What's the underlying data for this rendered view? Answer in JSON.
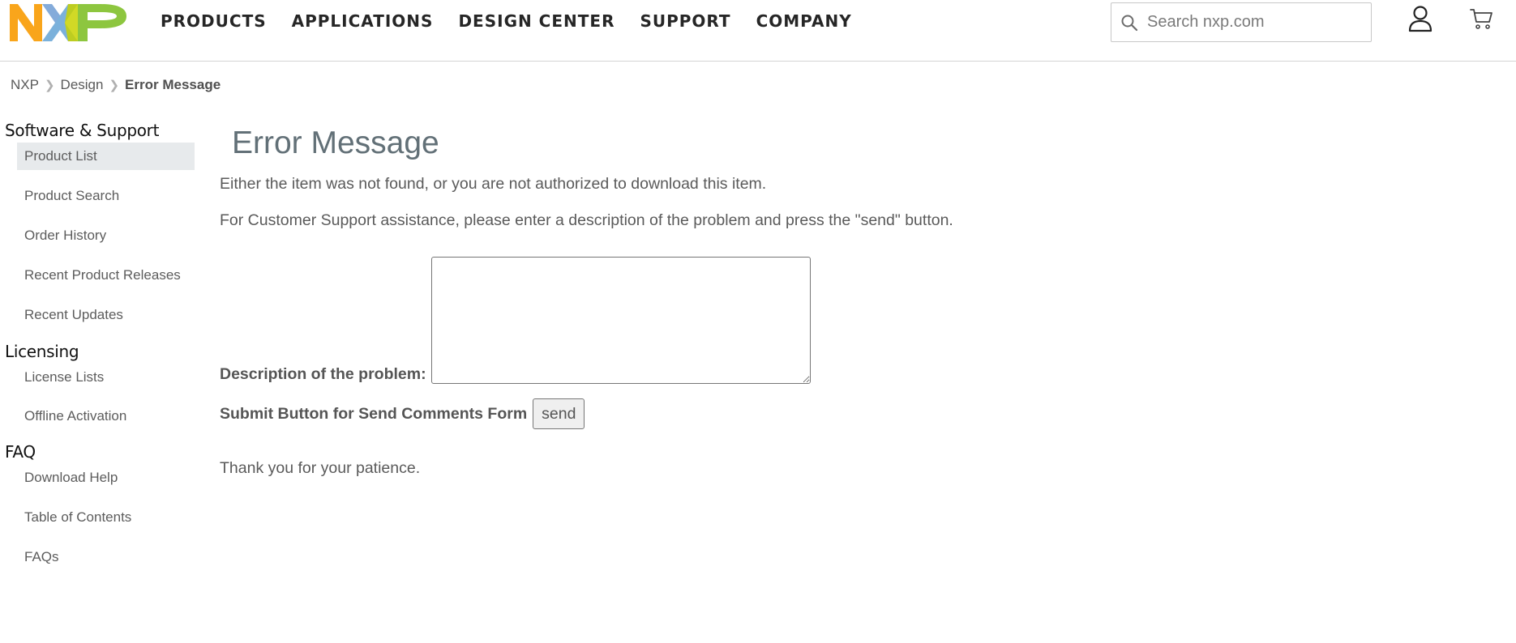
{
  "header": {
    "logo_text": "NXP",
    "nav": [
      "PRODUCTS",
      "APPLICATIONS",
      "DESIGN CENTER",
      "SUPPORT",
      "COMPANY"
    ],
    "search_placeholder": "Search nxp.com",
    "icons": {
      "search": "search-icon",
      "user": "user-icon",
      "cart": "cart-icon"
    }
  },
  "breadcrumb": [
    "NXP",
    "Design",
    "Error Message"
  ],
  "sidebar": {
    "groups": [
      {
        "heading": "Software & Support",
        "items": [
          "Product List",
          "Product Search",
          "Order History",
          "Recent Product Releases",
          "Recent Updates"
        ],
        "active": "Product List"
      },
      {
        "heading": "Licensing",
        "items": [
          "License Lists",
          "Offline Activation"
        ]
      },
      {
        "heading": "FAQ",
        "items": [
          "Download Help",
          "Table of Contents",
          "FAQs"
        ]
      }
    ]
  },
  "main": {
    "title": "Error Message",
    "message1": "Either the item was not found, or you are not authorized to download this item.",
    "message2": "For Customer Support assistance, please enter a description of the problem and press the \"send\" button.",
    "description_label": "Description of the problem:",
    "description_value": "",
    "submit_label": "Submit Button for Send Comments Form",
    "send_button": "send",
    "thanks": "Thank you for your patience."
  },
  "colors": {
    "logo_orange": "#f9a51b",
    "logo_blue": "#7bb1db",
    "logo_green": "#c9d200",
    "title": "#627077",
    "active_bg": "#e7eaec"
  }
}
